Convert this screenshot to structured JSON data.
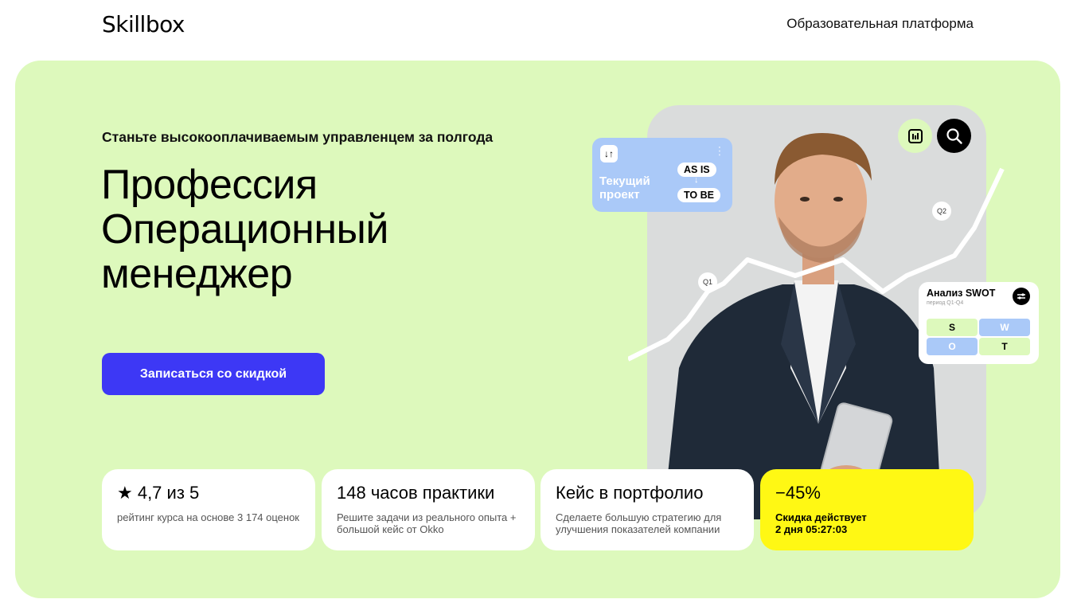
{
  "header": {
    "logo": "Skillbox",
    "platform_label": "Образовательная платформа"
  },
  "hero": {
    "subtitle": "Станьте высокооплачиваемым управленцем за полгода",
    "title_lines": [
      "Профессия",
      "Операционный",
      "менеджер"
    ],
    "cta_label": "Записаться со скидкой"
  },
  "decor": {
    "project_card": {
      "label_line1": "Текущий",
      "label_line2": "проект",
      "as_is": "AS IS",
      "to_be": "TO BE",
      "icon": "swap-arrows-icon"
    },
    "q1": "Q1",
    "q2": "Q2",
    "swot": {
      "title": "Анализ SWOT",
      "period": "период Q1-Q4",
      "s": "S",
      "w": "W",
      "o": "O",
      "t": "T"
    }
  },
  "stats": [
    {
      "heading": "★ 4,7 из 5",
      "desc": "рейтинг курса на основе 3 174 оценок"
    },
    {
      "heading": "148 часов практики",
      "desc": "Решите задачи из реального опыта + большой кейс от Okko"
    },
    {
      "heading": "Кейс в портфолио",
      "desc": "Сделаете большую стратегию для улучшения показателей компании"
    },
    {
      "heading": "−45%",
      "desc_line1": "Скидка действует",
      "desc_line2": "2 дня 05:27:03"
    }
  ],
  "colors": {
    "hero_bg": "#ddf9bc",
    "cta_bg": "#3d38f5",
    "sale_bg": "#fff814",
    "card_blue": "#aac9f8"
  }
}
